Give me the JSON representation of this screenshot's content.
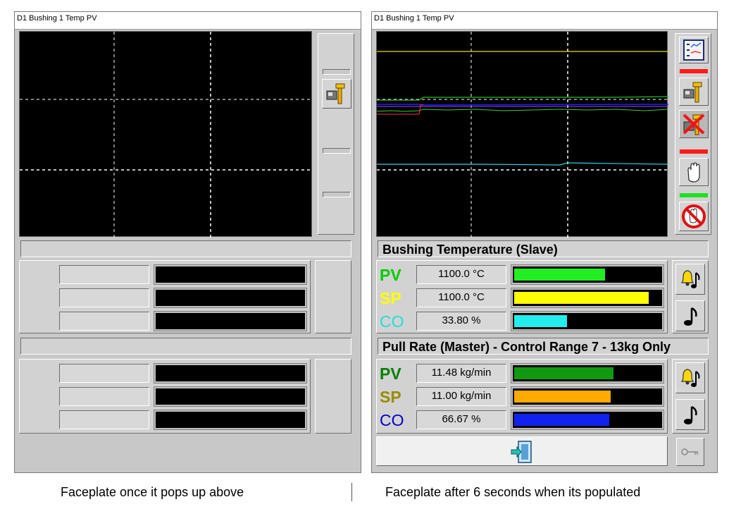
{
  "left": {
    "title": "D1 Bushing 1 Temp PV",
    "caption": "Faceplate once it pops up above"
  },
  "right": {
    "title": "D1 Bushing 1 Temp PV",
    "caption": "Faceplate after 6 seconds when its populated",
    "section1": {
      "title": "Bushing Temperature (Slave)",
      "rows": [
        {
          "label": "PV",
          "value": "1100.0 °C",
          "fill": 0.62,
          "label_color": "#00cc00",
          "bar_color": "#22ee22"
        },
        {
          "label": "SP",
          "value": "1100.0 °C",
          "fill": 0.92,
          "label_color": "#ffff00",
          "bar_color": "#ffff00"
        },
        {
          "label": "CO",
          "value": "33.80 %",
          "fill": 0.36,
          "label_color": "#22dddd",
          "bar_color": "#22eeee"
        }
      ]
    },
    "section2": {
      "title": "Pull Rate (Master) - Control Range 7 - 13kg Only",
      "rows": [
        {
          "label": "PV",
          "value": "11.48 kg/min",
          "fill": 0.68,
          "label_color": "#008000",
          "bar_color": "#119911"
        },
        {
          "label": "SP",
          "value": "11.00 kg/min",
          "fill": 0.66,
          "label_color": "#9a8a00",
          "bar_color": "#ffaa00"
        },
        {
          "label": "CO",
          "value": "66.67 %",
          "fill": 0.65,
          "label_color": "#0000cc",
          "bar_color": "#1122ee"
        }
      ]
    },
    "icons": {
      "trend": "trend-chart-icon",
      "tune": "tune-tool-icon",
      "tune_disabled": "tune-disabled-icon",
      "hand": "manual-hand-icon",
      "no_manual": "no-manual-icon",
      "alarm": "alarm-bell-icon",
      "horn": "horn-note-icon",
      "exit": "exit-door-icon",
      "key": "key-icon"
    }
  }
}
